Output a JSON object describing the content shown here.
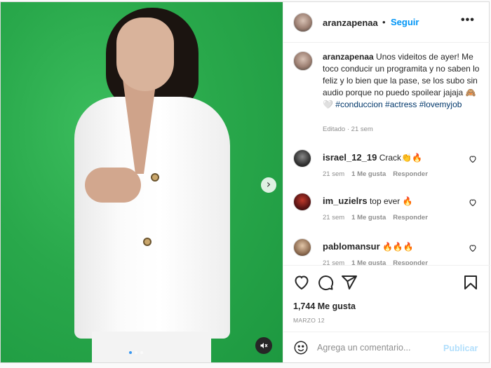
{
  "post": {
    "username": "aranzapenaa",
    "separator": "•",
    "follow_label": "Seguir",
    "more_label": "•••",
    "carousel": {
      "dots": 3,
      "active_index": 0
    }
  },
  "caption": {
    "username": "aranzapenaa",
    "text": "Unos videitos de ayer! Me toco conducir un programita y no saben lo feliz y lo bien que la pase, se los subo sin audio porque no puedo spoilear jajaja 🙈🤍",
    "tags": [
      "#conduccion",
      "#actress",
      "#lovemyjob"
    ],
    "meta": "Editado · 21 sem"
  },
  "comments": [
    {
      "username": "israel_12_19",
      "text": "Crack👏🔥",
      "time": "21 sem",
      "likes": "1 Me gusta",
      "reply": "Responder"
    },
    {
      "username": "im_uzielrs",
      "text": "top ever 🔥",
      "time": "21 sem",
      "likes": "1 Me gusta",
      "reply": "Responder"
    },
    {
      "username": "pablomansur",
      "text": "🔥🔥🔥",
      "time": "21 sem",
      "likes": "1 Me gusta",
      "reply": "Responder"
    }
  ],
  "engagement": {
    "likes": "1,744 Me gusta",
    "date": "MARZO 12"
  },
  "add_comment": {
    "placeholder": "Agrega un comentario...",
    "publish_label": "Publicar"
  },
  "icons": [
    "more-options-icon",
    "next-slide-icon",
    "mute-icon",
    "heart-icon",
    "comment-icon",
    "share-icon",
    "save-icon",
    "emoji-icon"
  ],
  "colors": {
    "accent": "#0095f6",
    "publish_disabled": "#b2dffc",
    "hashtag": "#00376b",
    "green_screen": "#29a84b"
  }
}
